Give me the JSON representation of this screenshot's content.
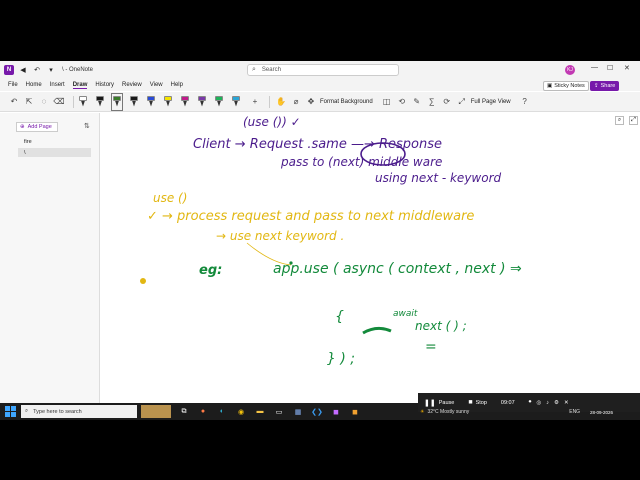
{
  "app": {
    "title": "\\ - OneNote",
    "logo": "N"
  },
  "search": {
    "placeholder": "Search"
  },
  "user": {
    "avatar_initials": "KJ"
  },
  "menu": [
    "File",
    "Home",
    "Insert",
    "Draw",
    "History",
    "Review",
    "View",
    "Help"
  ],
  "active_menu": "Draw",
  "header_buttons": {
    "sticky_notes": "Sticky Notes",
    "share": "Share"
  },
  "toolbar": {
    "pen_colors": [
      "#ffffff",
      "#1a1a1a",
      "#3a7b2a",
      "#1a1a1a",
      "#2b4bd6",
      "#f5e400",
      "#c01b8a",
      "#7a3aa8",
      "#1fb35a",
      "#2aa6d6"
    ],
    "format_background": "Format Background",
    "full_page_view": "Full Page View"
  },
  "sidebar": {
    "add_page": "Add Page",
    "pages": [
      "fire",
      "\\"
    ]
  },
  "ink": {
    "line1": "(use ()) ✓",
    "line2": "Client → Request    .same —→ Response",
    "line3": "pass   to  (next)  middle ware",
    "line4": "using next - keyword",
    "line5": "use ()",
    "line6": "✓ → process request and pass to next middleware",
    "line7": "→ use next keyword .",
    "line8": "eg:",
    "line9": "app.use ( async ( context , next ) ⇒",
    "line10": "{",
    "line11": "await",
    "line12": "next ( ) ;",
    "line13": "} ) ;",
    "line14": "="
  },
  "recorder": {
    "pause": "Pause",
    "stop": "Stop",
    "time": "09:07"
  },
  "taskbar": {
    "search_placeholder": "Type here to search",
    "weather": "32°C Mostly sunny",
    "lang": "ENG",
    "time": "28-09-2026"
  }
}
